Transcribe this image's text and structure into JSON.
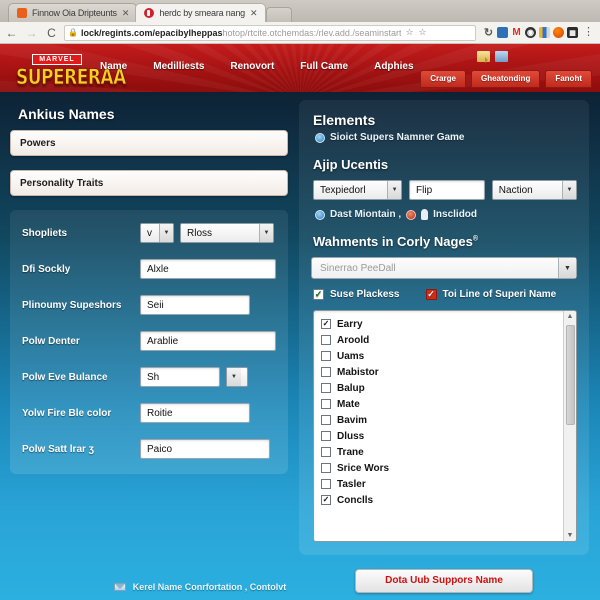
{
  "browser": {
    "tabs": [
      {
        "title": "Finnow Oia Dripteunts",
        "active": false
      },
      {
        "title": "herdc by smeara nang",
        "active": true
      }
    ],
    "close_glyph": "✕",
    "nav": {
      "back": "←",
      "forward": "→",
      "reload": "C"
    },
    "omnibox": {
      "lock_icon": "🔒",
      "url_bold": "lock/regints.com/epacibylheppas",
      "url_rest": "hotop/rtcite.otchemdas:/rlev.add./seaminstart",
      "star_glyph": "☆"
    },
    "extensions": [
      "refresh-icon",
      "blue-square-icon",
      "gmail-icon",
      "dark-circle-icon",
      "bars-icon",
      "orange-blob-icon",
      "grid-icon"
    ],
    "menu_glyph": "⋮"
  },
  "site_header": {
    "logo_top": "MARVEL",
    "logo_word": "SUPERERAA",
    "nav": [
      "Name",
      "Medilliests",
      "Renovort",
      "Full Came",
      "Adphies"
    ],
    "icons": [
      "note-icon",
      "blue-icon"
    ],
    "buttons": [
      "Crarge",
      "Gheatonding",
      "Fanoht"
    ]
  },
  "left": {
    "title": "Ankius Names",
    "field_powers": "Powers",
    "field_traits": "Personality Traits",
    "rows": [
      {
        "label": "Shopliets",
        "type": "two-select",
        "small_value": "v",
        "value": "Rloss"
      },
      {
        "label": "Dfi Sockly",
        "type": "input",
        "value": "Alxle"
      },
      {
        "label": "Plinoumy Supeshors",
        "type": "input",
        "value": "Seii"
      },
      {
        "label": "Polw Denter",
        "type": "input",
        "value": "Arablie"
      },
      {
        "label": "Polw Eve Bulance",
        "type": "input-select",
        "value": "Sh"
      },
      {
        "label": "Yolw Fire Ble color",
        "type": "input",
        "value": "Roitie"
      },
      {
        "label": "Polw Satt lrar ʒ",
        "type": "input",
        "value": "Paico"
      }
    ]
  },
  "right": {
    "title": "Elements",
    "subtitle": "Sioict Supers Namner Game",
    "section_two_title": "Ajip Ucentis",
    "triple": {
      "select_one": "Texpiedorl",
      "input_mid": "Flip",
      "select_two": "Naction"
    },
    "meta_line": {
      "first": "Dast Miontain ,",
      "second": "Insclidod"
    },
    "section_three_title": "Wahments in Corly Nages",
    "section_three_sup": "®",
    "dropdown_placeholder": "Sinerrao PeeDall",
    "checks": [
      {
        "label": "Suse Plackess",
        "checked": true,
        "style": "green"
      },
      {
        "label": "Toi Line of Superi Name",
        "checked": true,
        "style": "red"
      }
    ],
    "list": [
      {
        "label": "Earry",
        "checked": true
      },
      {
        "label": "Aroold",
        "checked": false
      },
      {
        "label": "Uams",
        "checked": false
      },
      {
        "label": "Mabistor",
        "checked": false
      },
      {
        "label": "Balup",
        "checked": false
      },
      {
        "label": "Mate",
        "checked": false
      },
      {
        "label": "Bavim",
        "checked": false
      },
      {
        "label": "Dluss",
        "checked": false
      },
      {
        "label": "Trane",
        "checked": false
      },
      {
        "label": "Srice Wors",
        "checked": false
      },
      {
        "label": "Tasler",
        "checked": false
      },
      {
        "label": "Conclls",
        "checked": true
      }
    ],
    "scroll_up": "▲",
    "scroll_down": "▼",
    "submit_label": "Dota Uub Suppors Name"
  },
  "footer": {
    "text": "Kerel Name Conrfortation , Contolvt"
  },
  "colors": {
    "header_red": "#a51212",
    "logo_yellow": "#f5d020",
    "submit_red": "#cc1111",
    "page_top": "#0e2235",
    "page_bottom": "#2bb0e0"
  }
}
